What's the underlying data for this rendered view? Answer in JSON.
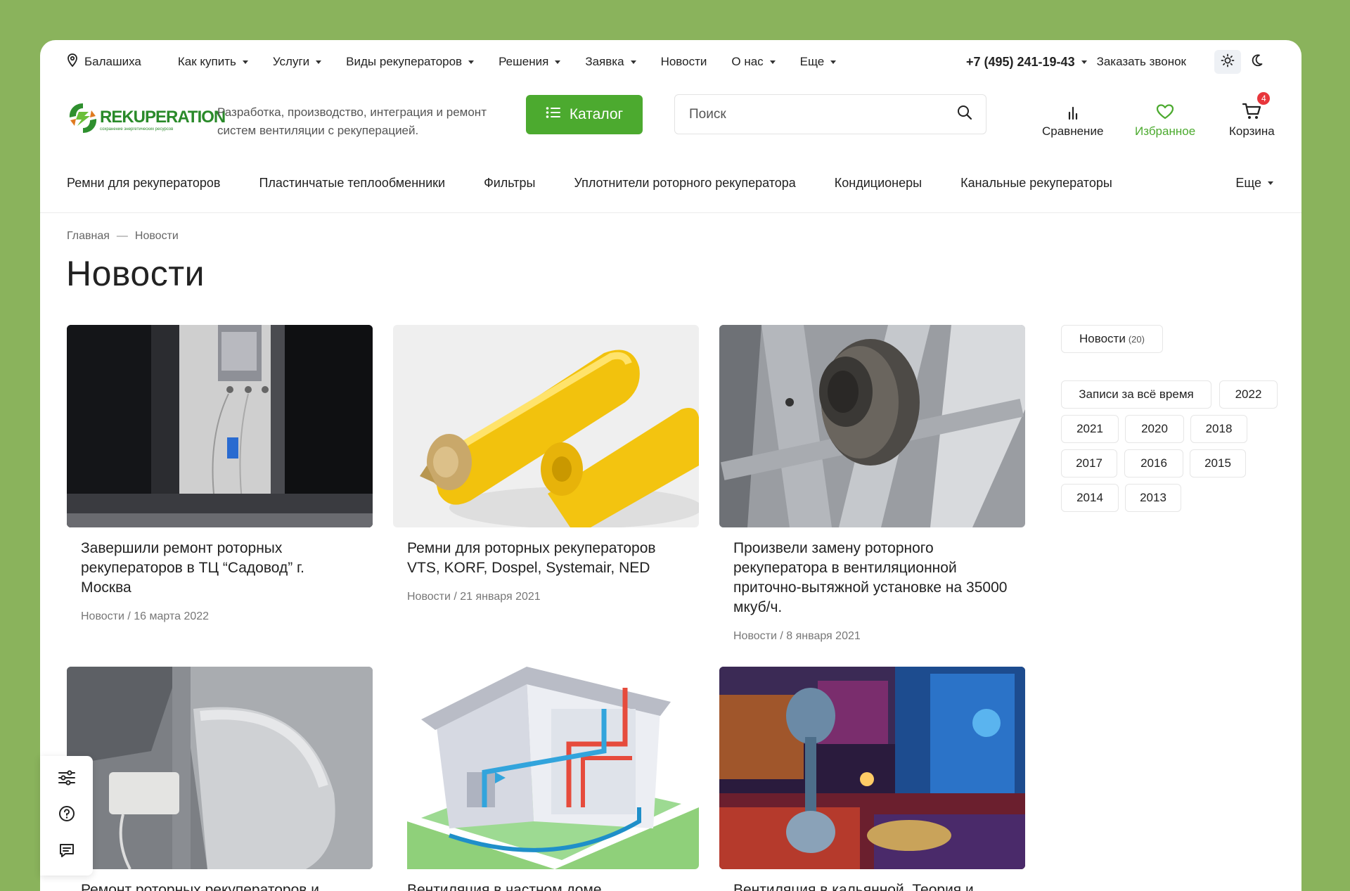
{
  "topbar": {
    "city": "Балашиха",
    "menu": [
      {
        "label": "Как купить",
        "dropdown": true
      },
      {
        "label": "Услуги",
        "dropdown": true
      },
      {
        "label": "Виды рекуператоров",
        "dropdown": true
      },
      {
        "label": "Решения",
        "dropdown": true
      },
      {
        "label": "Заявка",
        "dropdown": true
      },
      {
        "label": "Новости",
        "dropdown": false
      },
      {
        "label": "О нас",
        "dropdown": true
      },
      {
        "label": "Еще",
        "dropdown": true
      }
    ],
    "phone": "+7 (495) 241-19-43",
    "callback": "Заказать звонок"
  },
  "header": {
    "logo_text": "REKUPERATION",
    "logo_sub": "сохранение энергетических ресурсов",
    "tagline": "Разработка, производство, интеграция и ремонт систем вентиляции с рекуперацией.",
    "catalog_label": "Каталог",
    "search_placeholder": "Поиск",
    "compare_label": "Сравнение",
    "favorites_label": "Избранное",
    "cart_label": "Корзина",
    "cart_count": "4"
  },
  "catnav": {
    "items": [
      "Ремни для рекуператоров",
      "Пластинчатые теплообменники",
      "Фильтры",
      "Уплотнители роторного рекуператора",
      "Кондиционеры",
      "Канальные рекуператоры"
    ],
    "more": "Еще"
  },
  "breadcrumb": {
    "home": "Главная",
    "sep": "—",
    "current": "Новости"
  },
  "page_title": "Новости",
  "cards": [
    {
      "title": "Завершили ремонт роторных рекуператоров в ТЦ “Садовод” г. Москва",
      "meta": "Новости / 16 марта 2022"
    },
    {
      "title": "Ремни для роторных рекуператоров VTS, KORF, Dospel, Systemair, NED",
      "meta": "Новости / 21 января 2021"
    },
    {
      "title": "Произвели замену роторного рекуператора в вентиляционной приточно-вытяжной установке на 35000 мкуб/ч.",
      "meta": "Новости / 8 января 2021"
    },
    {
      "title": "Ремонт роторных рекуператоров и"
    },
    {
      "title": "Вентиляция в частном доме"
    },
    {
      "title": "Вентиляция в кальянной. Теория и"
    }
  ],
  "sidebar": {
    "section_label": "Новости",
    "section_count": "(20)",
    "all_time": "Записи за всё время",
    "years": [
      "2022",
      "2021",
      "2020",
      "2018",
      "2017",
      "2016",
      "2015",
      "2014",
      "2013"
    ]
  },
  "colors": {
    "background": "#8ab35c",
    "accent": "#4caa2f",
    "badge": "#e8363c"
  }
}
